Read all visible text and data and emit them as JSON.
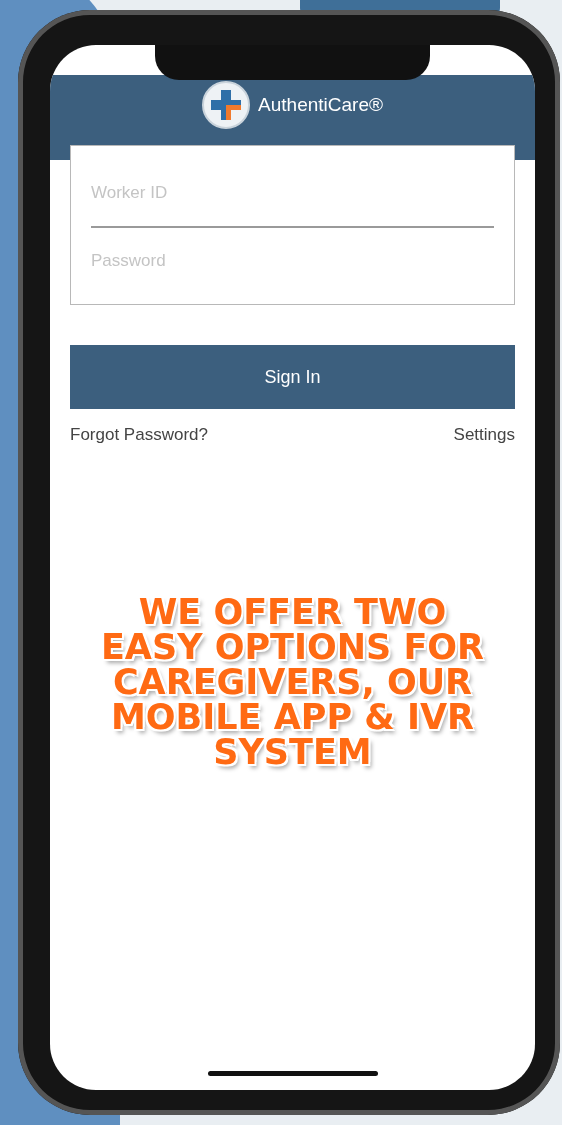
{
  "app": {
    "title": "AuthentiCare®"
  },
  "form": {
    "fields": [
      {
        "placeholder": "Worker ID"
      },
      {
        "placeholder": "Password"
      }
    ],
    "submit": "Sign In"
  },
  "links": [
    "Forgot Password?",
    "Settings"
  ],
  "overlay_text": "WE OFFER TWO EASY OPTIONS FOR CAREGIVERS, OUR MOBILE APP & IVR SYSTEM"
}
